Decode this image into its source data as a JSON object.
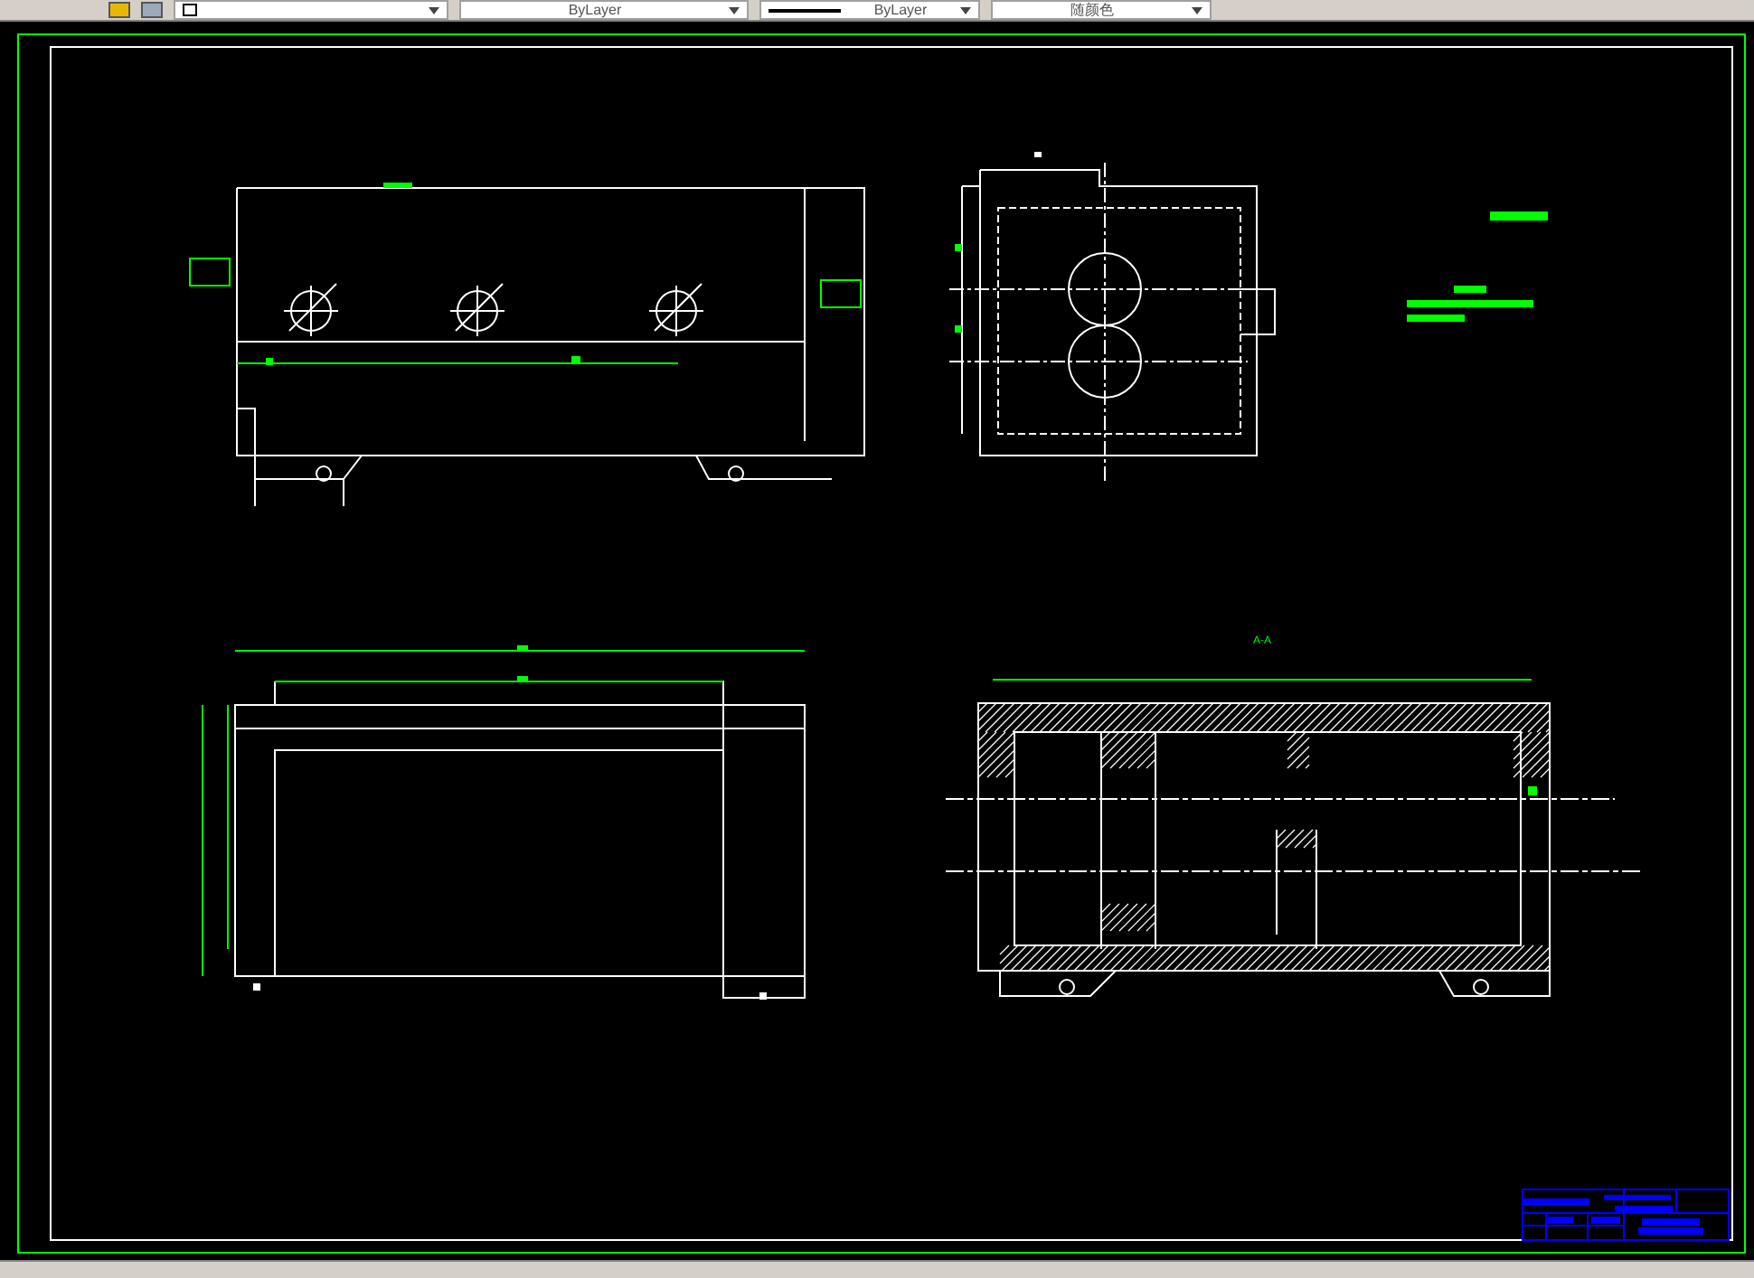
{
  "toolbar": {
    "dropdowns": [
      {
        "kind": "layer"
      },
      {
        "kind": "color",
        "value": "ByLayer"
      },
      {
        "kind": "linetype",
        "value": "ByLayer"
      },
      {
        "kind": "plotstyle",
        "value": "随颜色"
      }
    ]
  },
  "drawing": {
    "section_label": "A-A"
  }
}
